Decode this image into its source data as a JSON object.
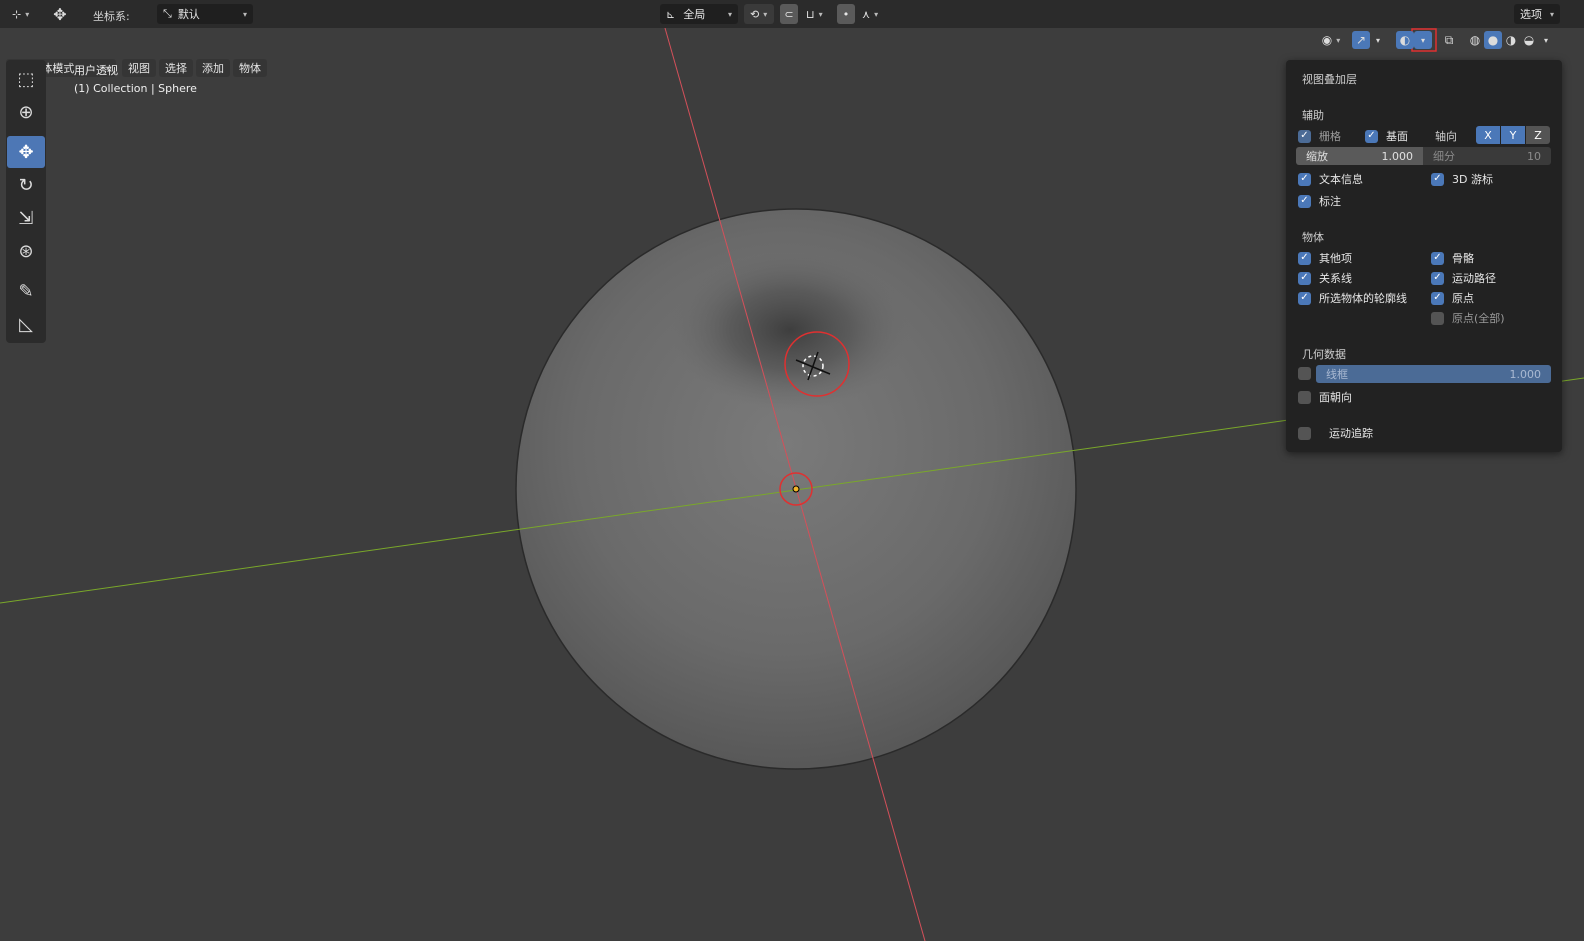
{
  "header": {
    "coord_label": "坐标系:",
    "coord_value": "默认",
    "transform_pivot": "全局",
    "options": "选项"
  },
  "menu": {
    "mode": "物体模式",
    "view": "视图",
    "select": "选择",
    "add": "添加",
    "object": "物体"
  },
  "viewport": {
    "view_name": "用户透视",
    "collection": "(1) Collection | Sphere"
  },
  "overlay_panel": {
    "title": "视图叠加层",
    "guides": {
      "section": "辅助",
      "grid": "栅格",
      "floor": "基面",
      "axes": "轴向",
      "x": "X",
      "y": "Y",
      "z": "Z",
      "scale_label": "缩放",
      "scale_value": "1.000",
      "subdiv_label": "细分",
      "subdiv_value": "10",
      "text_info": "文本信息",
      "cursor_3d": "3D 游标",
      "annotations": "标注"
    },
    "objects": {
      "section": "物体",
      "extras": "其他项",
      "bones": "骨骼",
      "relationship_lines": "关系线",
      "motion_paths": "运动路径",
      "outline_selected": "所选物体的轮廓线",
      "origins": "原点",
      "origins_all": "原点(全部)"
    },
    "geometry": {
      "section": "几何数据",
      "wireframe": "线框",
      "wireframe_value": "1.000",
      "face_orientation": "面朝向"
    },
    "motion_tracking": "运动追踪"
  },
  "colors": {
    "accent": "#4b78b8",
    "annotation_red": "#e03030",
    "x_axis": "#d4505a",
    "y_axis": "#7aa82a"
  }
}
